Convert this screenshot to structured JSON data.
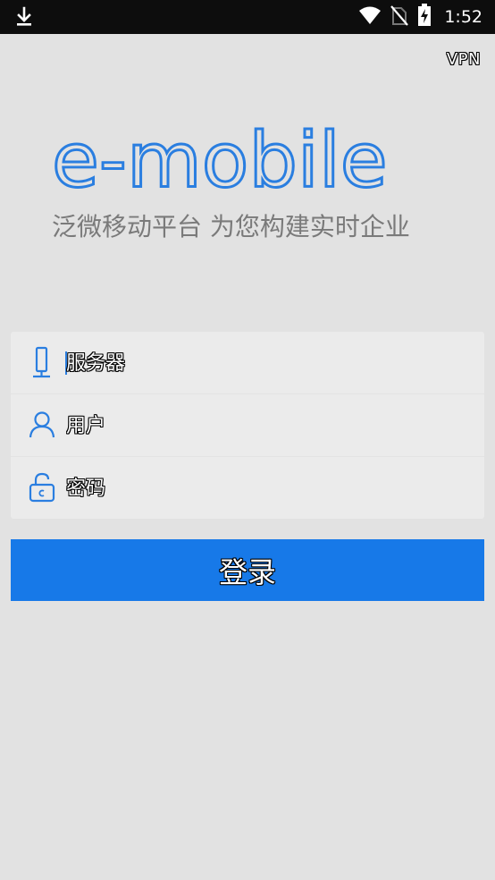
{
  "status_bar": {
    "time": "1:52",
    "icons": [
      "download-icon",
      "wifi-icon",
      "no-sim-icon",
      "battery-charging-icon"
    ]
  },
  "header": {
    "vpn_label": "VPN"
  },
  "brand": {
    "logo_text": "e-mobile",
    "slogan": "泛微移动平台  为您构建实时企业",
    "logo_color": "#2a7ee0",
    "slogan_color": "#7a7a7a"
  },
  "login_form": {
    "fields": [
      {
        "icon": "server-icon",
        "placeholder": "服务器",
        "value": ""
      },
      {
        "icon": "user-icon",
        "placeholder": "用户",
        "value": ""
      },
      {
        "icon": "lock-icon",
        "placeholder": "密码",
        "value": ""
      }
    ],
    "submit_label": "登录",
    "accent_color": "#1779e8"
  }
}
